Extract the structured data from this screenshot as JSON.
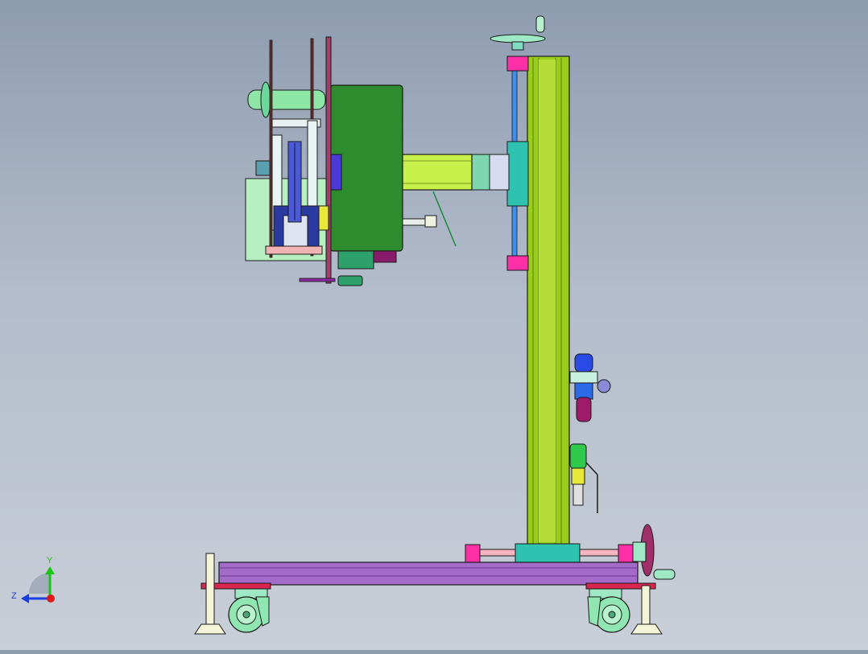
{
  "viewport": {
    "background_top": "#8e9cb0",
    "background_bottom": "#c9cfd8"
  },
  "model": {
    "colors": {
      "column": "#9acd1a",
      "arm": "#c8f04a",
      "motor_housing": "#2e8b2e",
      "base_frame": "#a46bc8",
      "feet_bar": "#d8264f",
      "clamp_blocks": "#ff2fa8",
      "carriage": "#2ec3b0",
      "guide_rod": "#3c8ff0",
      "wheels": "#8fe6b0",
      "outline": "#1a1a1a"
    },
    "parts": [
      "handwheel-top",
      "vertical-column",
      "horizontal-arm",
      "motor-housing",
      "welding-head-assembly",
      "air-filter-regulator",
      "ball-valve",
      "base-frame",
      "caster-wheel-left",
      "caster-wheel-right",
      "leveling-foot-left",
      "leveling-foot-right",
      "handwheel-base"
    ]
  },
  "triad": {
    "y_label": "Y",
    "z_label": "Z",
    "y_color": "#18c418",
    "z_color": "#1a3ee0",
    "origin_color": "#e01818"
  }
}
